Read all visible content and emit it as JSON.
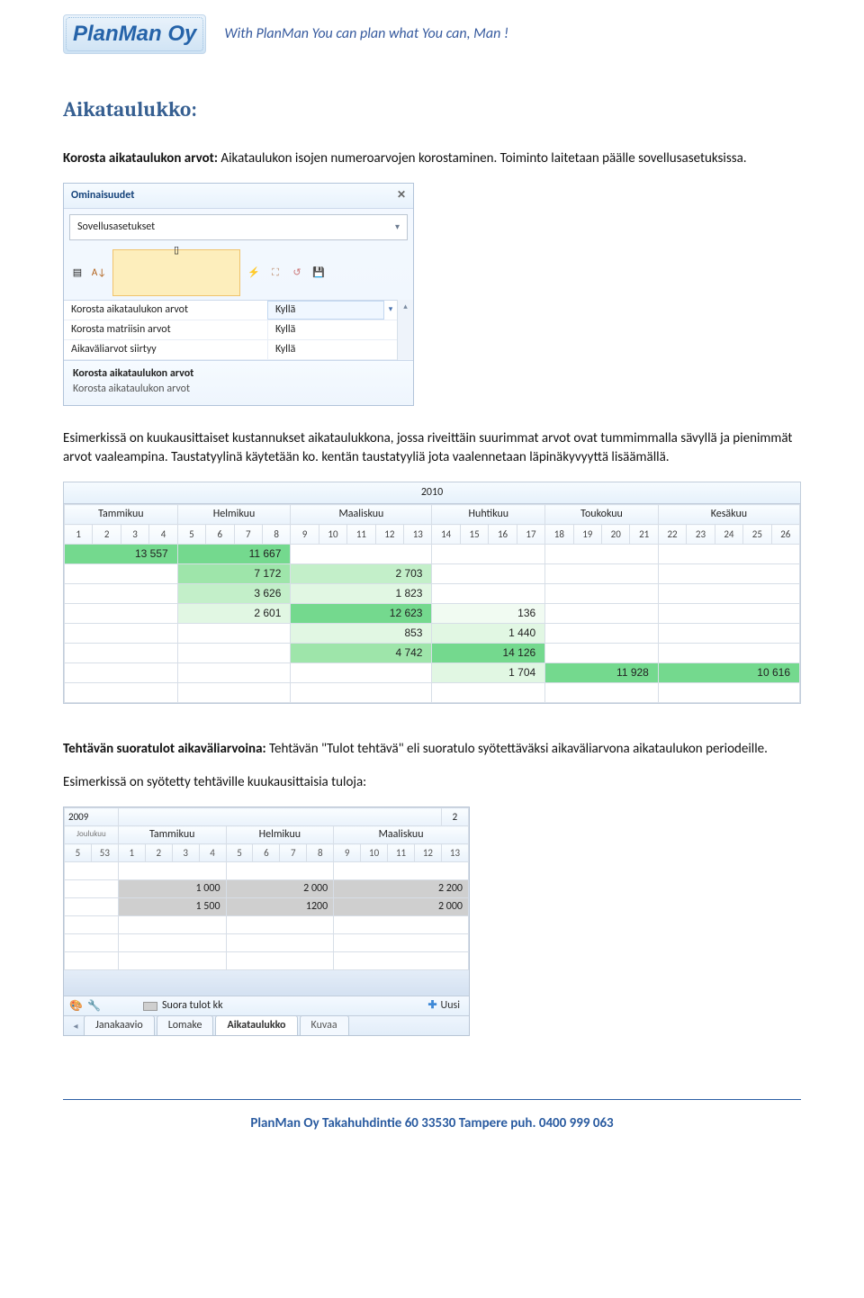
{
  "banner": {
    "logo_text": "PlanMan Oy",
    "tagline": "With PlanMan You can plan what You can, Man !"
  },
  "section_title": "Aikataulukko:",
  "para1_bold": "Korosta aikataulukon arvot:",
  "para1_rest": " Aikataulukon isojen numeroarvojen korostaminen. Toiminto laitetaan päälle sovellusasetuksissa.",
  "props": {
    "title": "Ominaisuudet",
    "combo": "Sovellusasetukset",
    "rows": [
      {
        "name": "Korosta aikataulukon arvot",
        "value": "Kyllä"
      },
      {
        "name": "Korosta matriisin arvot",
        "value": "Kyllä"
      },
      {
        "name": "Aikaväliarvot siirtyy",
        "value": "Kyllä"
      }
    ],
    "desc_title": "Korosta aikataulukon arvot",
    "desc_text": "Korosta aikataulukon arvot"
  },
  "para2": "Esimerkissä on kuukausittaiset kustannukset aikataulukkona, jossa riveittäin suurimmat arvot ovat tummimmalla sävyllä ja pienimmät arvot vaaleampina. Taustatyylinä käytetään ko. kentän taustatyyliä jota vaalennetaan läpinäkyvyyttä lisäämällä.",
  "schedule": {
    "year": "2010",
    "months": [
      "Tammikuu",
      "Helmikuu",
      "Maaliskuu",
      "Huhtikuu",
      "Toukokuu",
      "Kesäkuu"
    ],
    "month_spans": [
      4,
      4,
      5,
      4,
      4,
      5
    ],
    "weeks": [
      "1",
      "2",
      "3",
      "4",
      "5",
      "6",
      "7",
      "8",
      "9",
      "10",
      "11",
      "12",
      "13",
      "14",
      "15",
      "16",
      "17",
      "18",
      "19",
      "20",
      "21",
      "22",
      "23",
      "24",
      "25",
      "26"
    ],
    "rows": [
      [
        {
          "v": "13 557",
          "g": 1
        },
        {
          "v": "11 667",
          "g": 1
        },
        {
          "v": "",
          "g": 0
        },
        {
          "v": "",
          "g": 0
        },
        {
          "v": "",
          "g": 0
        },
        {
          "v": "",
          "g": 0
        }
      ],
      [
        {
          "v": "",
          "g": 0
        },
        {
          "v": "7 172",
          "g": 2
        },
        {
          "v": "2 703",
          "g": 3
        },
        {
          "v": "",
          "g": 0
        },
        {
          "v": "",
          "g": 0
        },
        {
          "v": "",
          "g": 0
        }
      ],
      [
        {
          "v": "",
          "g": 0
        },
        {
          "v": "3 626",
          "g": 3
        },
        {
          "v": "1 823",
          "g": 4
        },
        {
          "v": "",
          "g": 0
        },
        {
          "v": "",
          "g": 0
        },
        {
          "v": "",
          "g": 0
        }
      ],
      [
        {
          "v": "",
          "g": 0
        },
        {
          "v": "2 601",
          "g": 4
        },
        {
          "v": "12 623",
          "g": 1
        },
        {
          "v": "136",
          "g": 5
        },
        {
          "v": "",
          "g": 0
        },
        {
          "v": "",
          "g": 0
        }
      ],
      [
        {
          "v": "",
          "g": 0
        },
        {
          "v": "",
          "g": 0
        },
        {
          "v": "853",
          "g": 4
        },
        {
          "v": "1 440",
          "g": 4
        },
        {
          "v": "",
          "g": 0
        },
        {
          "v": "",
          "g": 0
        }
      ],
      [
        {
          "v": "",
          "g": 0
        },
        {
          "v": "",
          "g": 0
        },
        {
          "v": "4 742",
          "g": 2
        },
        {
          "v": "14 126",
          "g": 1
        },
        {
          "v": "",
          "g": 0
        },
        {
          "v": "",
          "g": 0
        }
      ],
      [
        {
          "v": "",
          "g": 0
        },
        {
          "v": "",
          "g": 0
        },
        {
          "v": "",
          "g": 0
        },
        {
          "v": "1 704",
          "g": 4
        },
        {
          "v": "11 928",
          "g": 1
        },
        {
          "v": "10 616",
          "g": 1
        }
      ],
      [
        {
          "v": "",
          "g": 0
        },
        {
          "v": "",
          "g": 0
        },
        {
          "v": "",
          "g": 0
        },
        {
          "v": "",
          "g": 0
        },
        {
          "v": "",
          "g": 0
        },
        {
          "v": "",
          "g": 0
        }
      ]
    ]
  },
  "para3_bold": "Tehtävän suoratulot aikaväliarvoina:",
  "para3_rest": " Tehtävän \"Tulot tehtävä\" eli suoratulo syötettäväksi aikaväliarvona aikataulukon periodeille.",
  "para4": "Esimerkissä on syötetty tehtäville kuukausittaisia tuloja:",
  "mini": {
    "year_left": "2009",
    "year_right": "2",
    "small_left": "Joulukuu",
    "months": [
      "Tammikuu",
      "Helmikuu",
      "Maaliskuu"
    ],
    "weeks_left": [
      "5",
      "53"
    ],
    "weeks": [
      "1",
      "2",
      "3",
      "4",
      "5",
      "6",
      "7",
      "8",
      "9",
      "10",
      "11",
      "12",
      "13"
    ],
    "rows": [
      [
        "",
        "",
        "",
        ""
      ],
      [
        "",
        "1 000",
        "2 000",
        "2 200"
      ],
      [
        "",
        "1 500",
        "1200",
        "2 000"
      ],
      [
        "",
        "",
        "",
        ""
      ],
      [
        "",
        "",
        "",
        ""
      ],
      [
        "",
        "",
        "",
        ""
      ]
    ],
    "legend": "Suora tulot kk",
    "new_label": "Uusi",
    "tabs": [
      "Janakaavio",
      "Lomake",
      "Aikataulukko",
      "Kuvaa"
    ]
  },
  "footer": "PlanMan Oy   Takahuhdintie 60   33530 Tampere   puh. 0400 999 063"
}
